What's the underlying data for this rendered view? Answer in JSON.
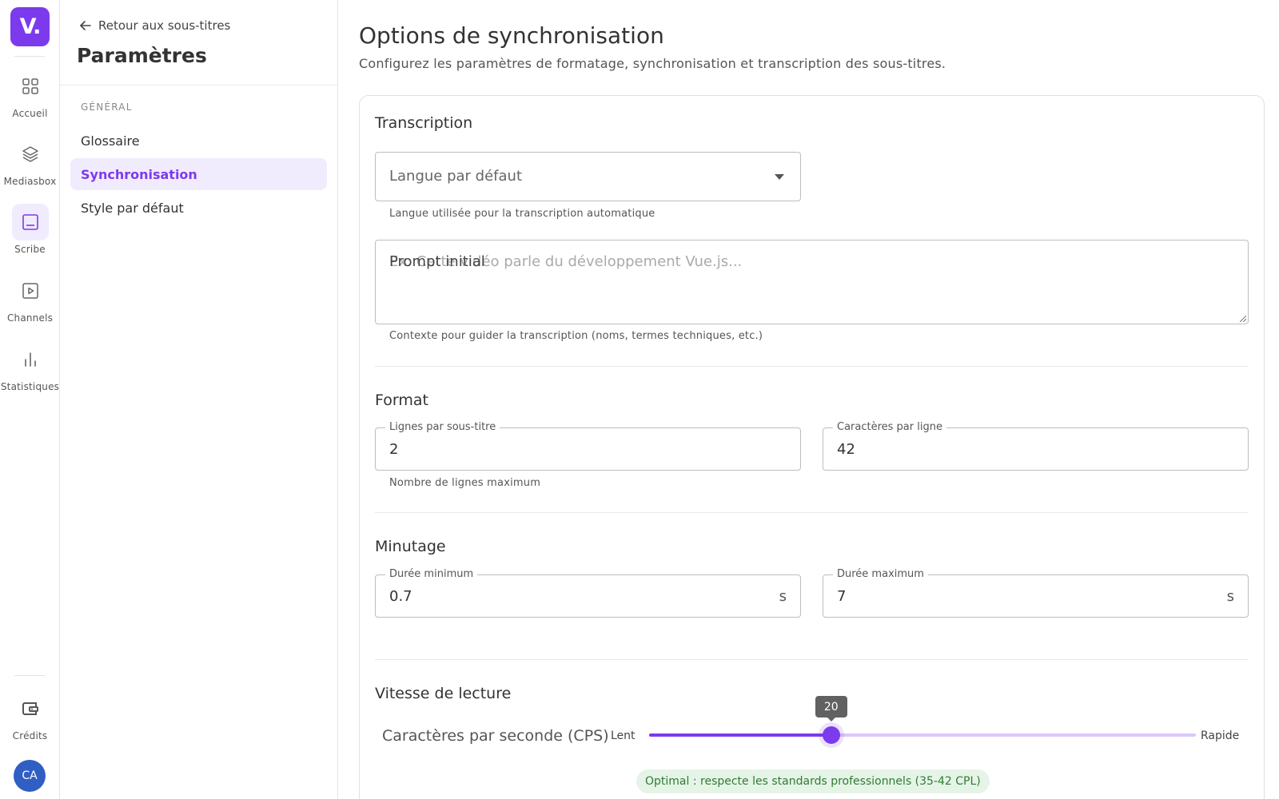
{
  "rail": {
    "logo": "V.",
    "items": [
      {
        "label": "Accueil",
        "icon": "grid-icon"
      },
      {
        "label": "Mediasbox",
        "icon": "layers-icon"
      },
      {
        "label": "Scribe",
        "icon": "subtitles-icon"
      },
      {
        "label": "Channels",
        "icon": "play-square-icon"
      },
      {
        "label": "Statistiques",
        "icon": "bar-chart-icon"
      }
    ],
    "credits_label": "Crédits",
    "avatar_initials": "CA",
    "accent": "#7c3aed",
    "avatar_color": "#2f5fc4"
  },
  "nav": {
    "back_label": "Retour aux sous-titres",
    "title": "Paramètres",
    "section": "GÉNÉRAL",
    "items": [
      {
        "label": "Glossaire",
        "active": false
      },
      {
        "label": "Synchronisation",
        "active": true
      },
      {
        "label": "Style par défaut",
        "active": false
      }
    ]
  },
  "main": {
    "title": "Options de synchronisation",
    "subtitle": "Configurez les paramètres de formatage, synchronisation et transcription des sous-titres.",
    "transcription": {
      "title": "Transcription",
      "language": {
        "label": "Langue par défaut",
        "helper": "Langue utilisée pour la transcription automatique"
      },
      "prompt": {
        "label": "Prompt initial",
        "placeholder": "Ex: Cette vidéo parle du développement Vue.js...",
        "helper": "Contexte pour guider la transcription (noms, termes techniques, etc.)"
      }
    },
    "format": {
      "title": "Format",
      "lines": {
        "label": "Lignes par sous-titre",
        "value": "2",
        "helper": "Nombre de lignes maximum"
      },
      "chars": {
        "label": "Caractères par ligne",
        "value": "42"
      }
    },
    "timing": {
      "title": "Minutage",
      "min": {
        "label": "Durée minimum",
        "value": "0.7",
        "unit": "s"
      },
      "max": {
        "label": "Durée maximum",
        "value": "7",
        "unit": "s"
      }
    },
    "speed": {
      "title": "Vitesse de lecture",
      "label": "Caractères par seconde (CPS)",
      "min_label": "Lent",
      "max_label": "Rapide",
      "value": 20,
      "value_text": "20",
      "fill_fraction": 0.333,
      "chip": "Optimal : respecte les standards professionnels (35-42 CPL)",
      "chip_color": "#2e7d32"
    }
  }
}
